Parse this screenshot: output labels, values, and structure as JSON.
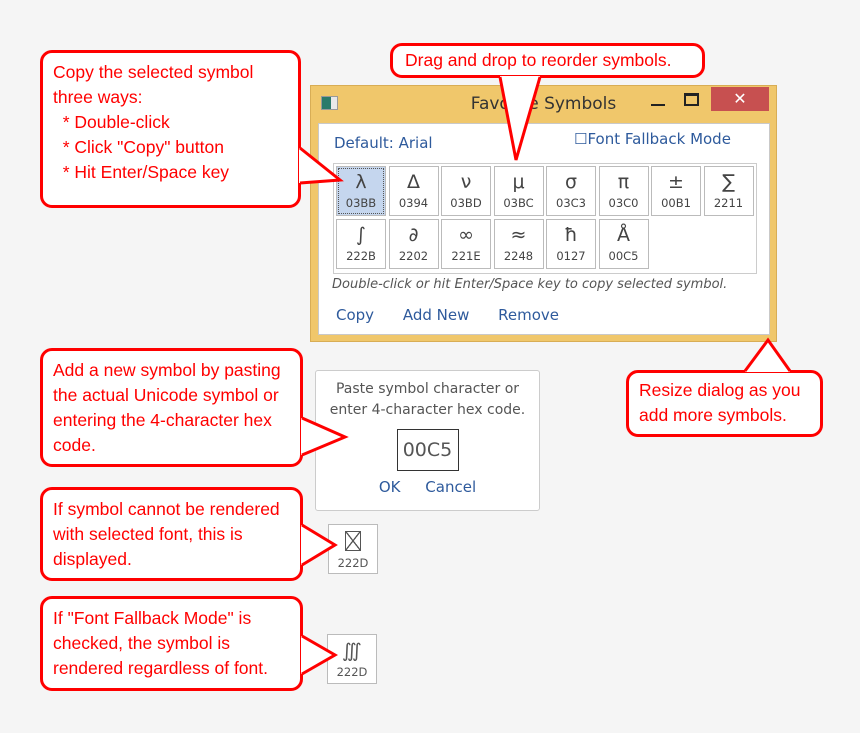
{
  "callouts": {
    "copy": "Copy the selected symbol\nthree ways:\n  * Double-click\n  * Click \"Copy\" button\n  * Hit Enter/Space key",
    "drag": "Drag and drop to reorder symbols.",
    "resize": "Resize dialog as you\nadd more symbols.",
    "add": "Add a new symbol by pasting\nthe actual Unicode symbol or\nentering the 4-character hex\ncode.",
    "cannot": "If symbol cannot be rendered\nwith selected font, this is\ndisplayed.",
    "fallback": "If \"Font Fallback Mode\" is\nchecked, the symbol is\nrendered regardless of font."
  },
  "dialog": {
    "title": "Favorite Symbols",
    "close": "✕",
    "default_font": "Default: Arial",
    "fallback_mode": "☐Font Fallback Mode",
    "symbols": [
      {
        "sym": "λ",
        "code": "03BB",
        "selected": true
      },
      {
        "sym": "Δ",
        "code": "0394"
      },
      {
        "sym": "ν",
        "code": "03BD"
      },
      {
        "sym": "μ",
        "code": "03BC"
      },
      {
        "sym": "σ",
        "code": "03C3"
      },
      {
        "sym": "π",
        "code": "03C0"
      },
      {
        "sym": "±",
        "code": "00B1"
      },
      {
        "sym": "∑",
        "code": "2211"
      },
      {
        "sym": "∫",
        "code": "222B"
      },
      {
        "sym": "∂",
        "code": "2202"
      },
      {
        "sym": "∞",
        "code": "221E"
      },
      {
        "sym": "≈",
        "code": "2248"
      },
      {
        "sym": "ħ",
        "code": "0127"
      },
      {
        "sym": "Å",
        "code": "00C5"
      }
    ],
    "hint": "Double-click or hit Enter/Space key to copy selected symbol.",
    "copy": "Copy",
    "add_new": "Add New",
    "remove": "Remove"
  },
  "paste": {
    "prompt": "Paste symbol character or\nenter 4-character hex code.",
    "value": "00C5",
    "ok": "OK",
    "cancel": "Cancel"
  },
  "examples": {
    "missing": {
      "code": "222D"
    },
    "fallback": {
      "sym": "∭",
      "code": "222D"
    }
  }
}
